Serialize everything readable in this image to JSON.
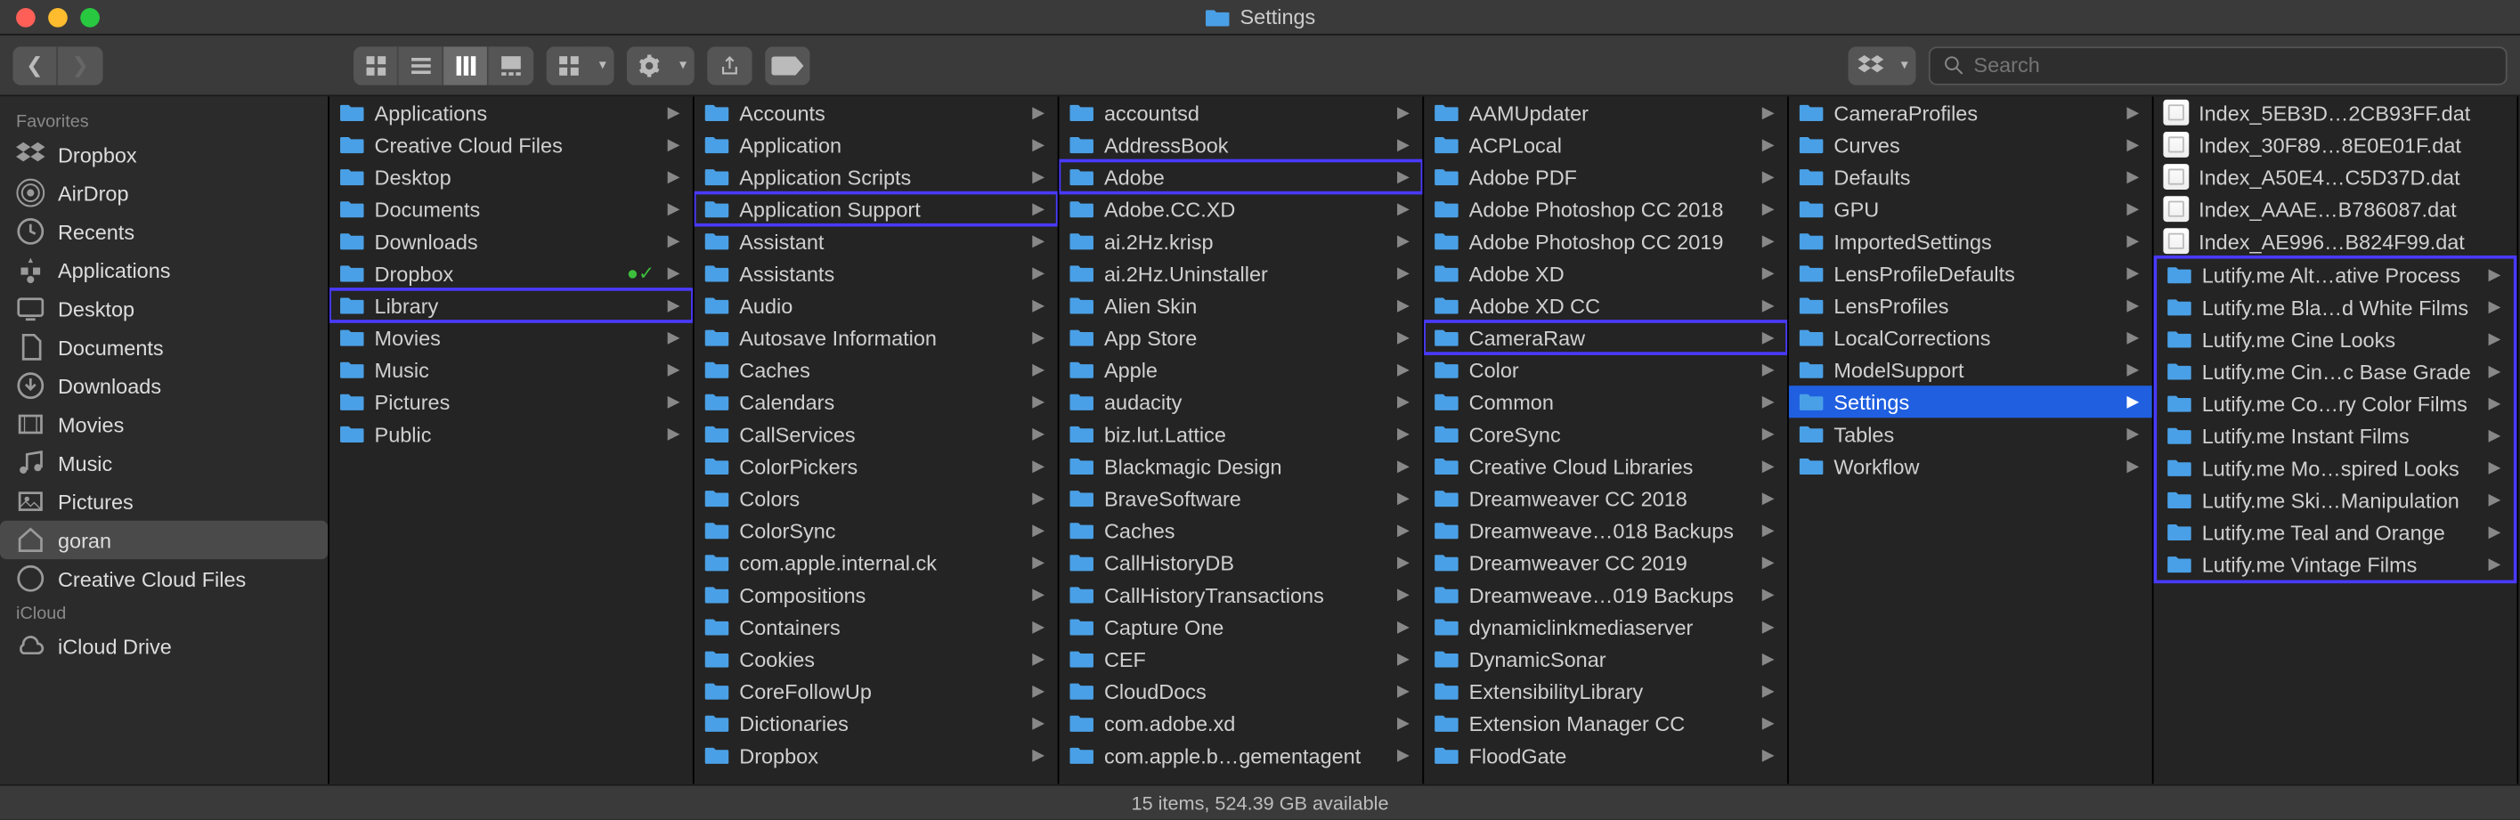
{
  "window_title": "Settings",
  "search_placeholder": "Search",
  "status_bar": "15 items, 524.39 GB available",
  "sidebar": {
    "sections": [
      {
        "header": "Favorites",
        "items": [
          {
            "icon": "dropbox",
            "label": "Dropbox"
          },
          {
            "icon": "airdrop",
            "label": "AirDrop"
          },
          {
            "icon": "clock",
            "label": "Recents"
          },
          {
            "icon": "apps",
            "label": "Applications"
          },
          {
            "icon": "desktop",
            "label": "Desktop"
          },
          {
            "icon": "doc",
            "label": "Documents"
          },
          {
            "icon": "download",
            "label": "Downloads"
          },
          {
            "icon": "movie",
            "label": "Movies"
          },
          {
            "icon": "music",
            "label": "Music"
          },
          {
            "icon": "picture",
            "label": "Pictures"
          },
          {
            "icon": "home",
            "label": "goran",
            "selected": true
          },
          {
            "icon": "cc",
            "label": "Creative Cloud Files"
          }
        ]
      },
      {
        "header": "iCloud",
        "items": [
          {
            "icon": "cloud",
            "label": "iCloud Drive"
          }
        ]
      }
    ]
  },
  "columns": [
    {
      "items": [
        {
          "t": "folder",
          "label": "Applications",
          "arr": true
        },
        {
          "t": "folder",
          "label": "Creative Cloud Files",
          "arr": true
        },
        {
          "t": "folder",
          "label": "Desktop",
          "arr": true
        },
        {
          "t": "folder",
          "label": "Documents",
          "arr": true
        },
        {
          "t": "folder",
          "label": "Downloads",
          "arr": true
        },
        {
          "t": "folder",
          "label": "Dropbox",
          "arr": true,
          "check": true
        },
        {
          "t": "folder",
          "label": "Library",
          "arr": true,
          "box": true
        },
        {
          "t": "folder",
          "label": "Movies",
          "arr": true
        },
        {
          "t": "folder",
          "label": "Music",
          "arr": true
        },
        {
          "t": "folder",
          "label": "Pictures",
          "arr": true
        },
        {
          "t": "folder",
          "label": "Public",
          "arr": true
        }
      ]
    },
    {
      "items": [
        {
          "t": "folder",
          "label": "Accounts",
          "arr": true
        },
        {
          "t": "folder",
          "label": "Application",
          "arr": true
        },
        {
          "t": "folder",
          "label": "Application Scripts",
          "arr": true
        },
        {
          "t": "folder",
          "label": "Application Support",
          "arr": true,
          "box": true
        },
        {
          "t": "folder",
          "label": "Assistant",
          "arr": true
        },
        {
          "t": "folder",
          "label": "Assistants",
          "arr": true
        },
        {
          "t": "folder",
          "label": "Audio",
          "arr": true
        },
        {
          "t": "folder",
          "label": "Autosave Information",
          "arr": true
        },
        {
          "t": "folder",
          "label": "Caches",
          "arr": true
        },
        {
          "t": "folder",
          "label": "Calendars",
          "arr": true
        },
        {
          "t": "folder",
          "label": "CallServices",
          "arr": true
        },
        {
          "t": "folder",
          "label": "ColorPickers",
          "arr": true
        },
        {
          "t": "folder",
          "label": "Colors",
          "arr": true
        },
        {
          "t": "folder",
          "label": "ColorSync",
          "arr": true
        },
        {
          "t": "folder",
          "label": "com.apple.internal.ck",
          "arr": true
        },
        {
          "t": "folder",
          "label": "Compositions",
          "arr": true
        },
        {
          "t": "folder",
          "label": "Containers",
          "arr": true
        },
        {
          "t": "folder",
          "label": "Cookies",
          "arr": true
        },
        {
          "t": "folder",
          "label": "CoreFollowUp",
          "arr": true
        },
        {
          "t": "folder",
          "label": "Dictionaries",
          "arr": true
        },
        {
          "t": "folder",
          "label": "Dropbox",
          "arr": true
        }
      ]
    },
    {
      "items": [
        {
          "t": "folder",
          "label": "accountsd",
          "arr": true
        },
        {
          "t": "folder",
          "label": "AddressBook",
          "arr": true
        },
        {
          "t": "folder",
          "label": "Adobe",
          "arr": true,
          "box": true
        },
        {
          "t": "folder",
          "label": "Adobe.CC.XD",
          "arr": true
        },
        {
          "t": "folder",
          "label": "ai.2Hz.krisp",
          "arr": true
        },
        {
          "t": "folder",
          "label": "ai.2Hz.Uninstaller",
          "arr": true
        },
        {
          "t": "folder",
          "label": "Alien Skin",
          "arr": true
        },
        {
          "t": "folder",
          "label": "App Store",
          "arr": true
        },
        {
          "t": "folder",
          "label": "Apple",
          "arr": true
        },
        {
          "t": "folder",
          "label": "audacity",
          "arr": true
        },
        {
          "t": "folder",
          "label": "biz.lut.Lattice",
          "arr": true
        },
        {
          "t": "folder",
          "label": "Blackmagic Design",
          "arr": true
        },
        {
          "t": "folder",
          "label": "BraveSoftware",
          "arr": true
        },
        {
          "t": "folder",
          "label": "Caches",
          "arr": true
        },
        {
          "t": "folder",
          "label": "CallHistoryDB",
          "arr": true
        },
        {
          "t": "folder",
          "label": "CallHistoryTransactions",
          "arr": true
        },
        {
          "t": "folder",
          "label": "Capture One",
          "arr": true
        },
        {
          "t": "folder",
          "label": "CEF",
          "arr": true
        },
        {
          "t": "folder",
          "label": "CloudDocs",
          "arr": true
        },
        {
          "t": "folder",
          "label": "com.adobe.xd",
          "arr": true
        },
        {
          "t": "folder",
          "label": "com.apple.b…gementagent",
          "arr": true
        }
      ]
    },
    {
      "items": [
        {
          "t": "folder",
          "label": "AAMUpdater",
          "arr": true
        },
        {
          "t": "folder",
          "label": "ACPLocal",
          "arr": true
        },
        {
          "t": "folder",
          "label": "Adobe PDF",
          "arr": true
        },
        {
          "t": "folder",
          "label": "Adobe Photoshop CC 2018",
          "arr": true
        },
        {
          "t": "folder",
          "label": "Adobe Photoshop CC 2019",
          "arr": true
        },
        {
          "t": "folder",
          "label": "Adobe XD",
          "arr": true
        },
        {
          "t": "folder",
          "label": "Adobe XD CC",
          "arr": true
        },
        {
          "t": "folder",
          "label": "CameraRaw",
          "arr": true,
          "box": true
        },
        {
          "t": "folder",
          "label": "Color",
          "arr": true
        },
        {
          "t": "folder",
          "label": "Common",
          "arr": true
        },
        {
          "t": "folder",
          "label": "CoreSync",
          "arr": true
        },
        {
          "t": "folder",
          "label": "Creative Cloud Libraries",
          "arr": true
        },
        {
          "t": "folder",
          "label": "Dreamweaver CC 2018",
          "arr": true
        },
        {
          "t": "folder",
          "label": "Dreamweave…018 Backups",
          "arr": true
        },
        {
          "t": "folder",
          "label": "Dreamweaver CC 2019",
          "arr": true
        },
        {
          "t": "folder",
          "label": "Dreamweave…019 Backups",
          "arr": true
        },
        {
          "t": "folder",
          "label": "dynamiclinkmediaserver",
          "arr": true
        },
        {
          "t": "folder",
          "label": "DynamicSonar",
          "arr": true
        },
        {
          "t": "folder",
          "label": "ExtensibilityLibrary",
          "arr": true
        },
        {
          "t": "folder",
          "label": "Extension Manager CC",
          "arr": true
        },
        {
          "t": "folder",
          "label": "FloodGate",
          "arr": true
        }
      ]
    },
    {
      "items": [
        {
          "t": "folder",
          "label": "CameraProfiles",
          "arr": true
        },
        {
          "t": "folder",
          "label": "Curves",
          "arr": true
        },
        {
          "t": "folder",
          "label": "Defaults",
          "arr": true
        },
        {
          "t": "folder",
          "label": "GPU",
          "arr": true
        },
        {
          "t": "folder",
          "label": "ImportedSettings",
          "arr": true
        },
        {
          "t": "folder",
          "label": "LensProfileDefaults",
          "arr": true
        },
        {
          "t": "folder",
          "label": "LensProfiles",
          "arr": true
        },
        {
          "t": "folder",
          "label": "LocalCorrections",
          "arr": true
        },
        {
          "t": "folder",
          "label": "ModelSupport",
          "arr": true
        },
        {
          "t": "folder",
          "label": "Settings",
          "arr": true,
          "sel": true
        },
        {
          "t": "folder",
          "label": "Tables",
          "arr": true
        },
        {
          "t": "folder",
          "label": "Workflow",
          "arr": true
        }
      ]
    },
    {
      "items": [
        {
          "t": "file",
          "label": "Index_5EB3D…2CB93FF.dat"
        },
        {
          "t": "file",
          "label": "Index_30F89…8E0E01F.dat"
        },
        {
          "t": "file",
          "label": "Index_A50E4…C5D37D.dat"
        },
        {
          "t": "file",
          "label": "Index_AAAE…B786087.dat"
        },
        {
          "t": "file",
          "label": "Index_AE996…B824F99.dat"
        },
        {
          "t": "folder",
          "label": "Lutify.me Alt…ative Process",
          "arr": true,
          "group": "start"
        },
        {
          "t": "folder",
          "label": "Lutify.me Bla…d White Films",
          "arr": true
        },
        {
          "t": "folder",
          "label": "Lutify.me Cine Looks",
          "arr": true
        },
        {
          "t": "folder",
          "label": "Lutify.me Cin…c Base Grade",
          "arr": true
        },
        {
          "t": "folder",
          "label": "Lutify.me Co…ry Color Films",
          "arr": true
        },
        {
          "t": "folder",
          "label": "Lutify.me Instant Films",
          "arr": true
        },
        {
          "t": "folder",
          "label": "Lutify.me Mo…spired Looks",
          "arr": true
        },
        {
          "t": "folder",
          "label": "Lutify.me Ski…Manipulation",
          "arr": true
        },
        {
          "t": "folder",
          "label": "Lutify.me Teal and Orange",
          "arr": true
        },
        {
          "t": "folder",
          "label": "Lutify.me Vintage Films",
          "arr": true,
          "group": "end"
        }
      ]
    }
  ]
}
